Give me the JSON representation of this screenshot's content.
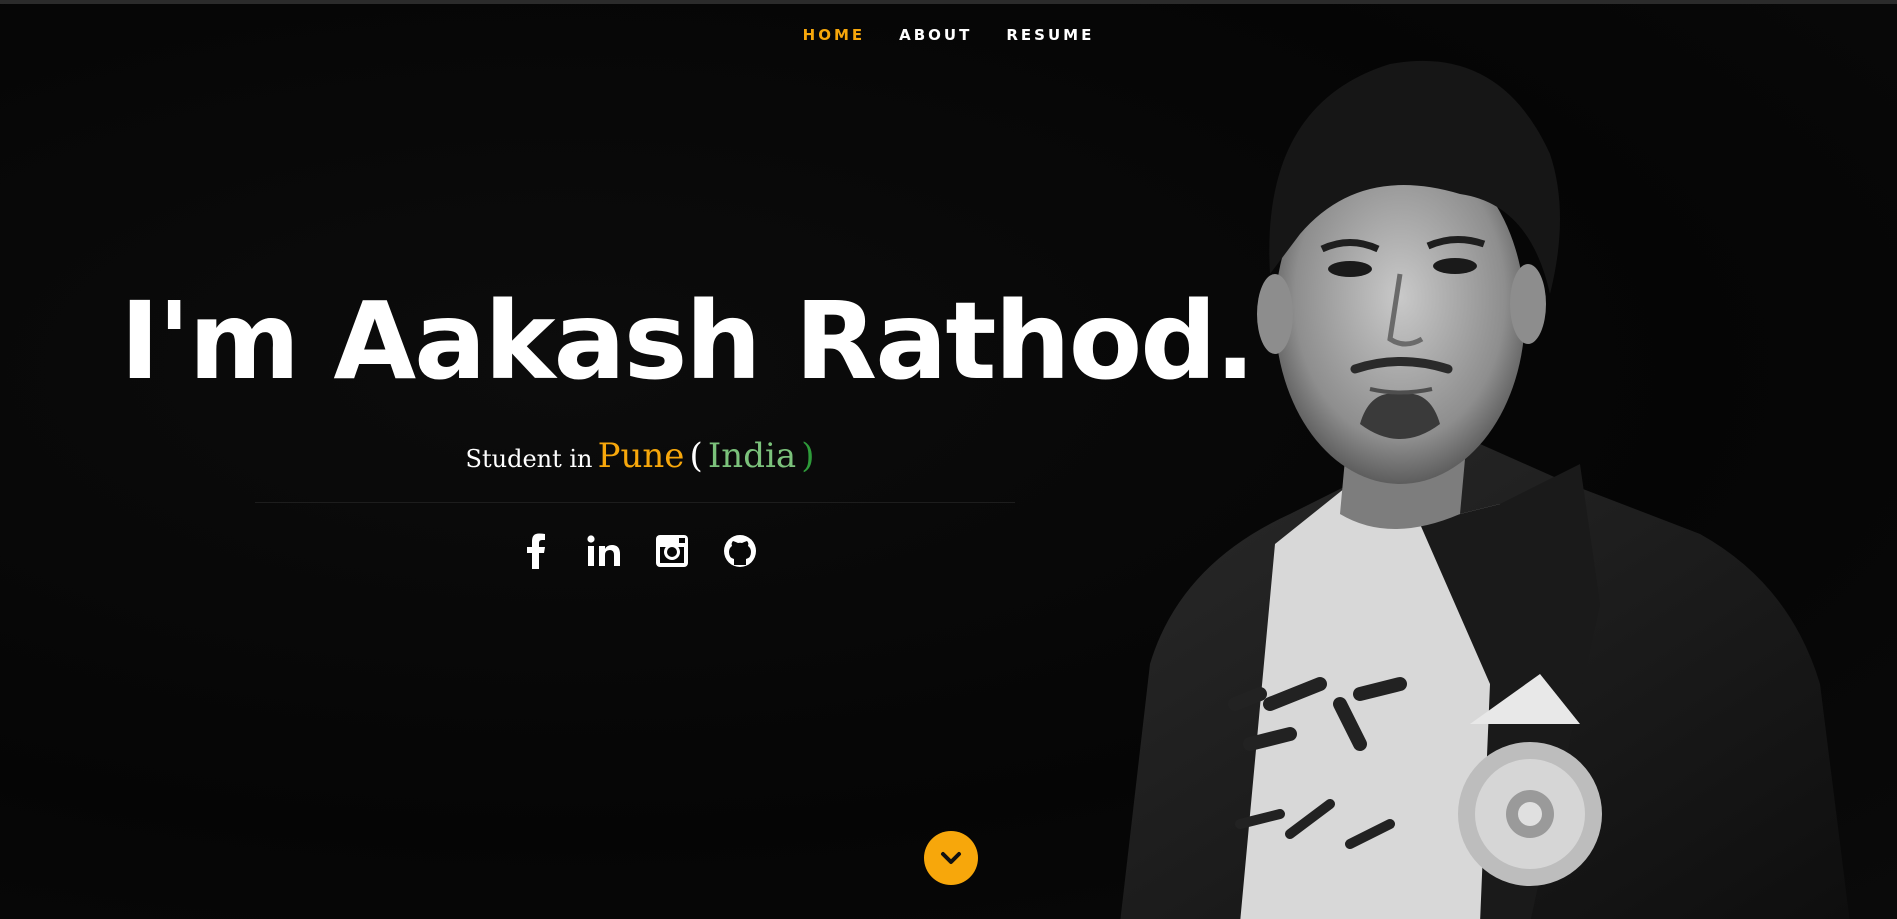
{
  "nav": {
    "items": [
      {
        "label": "HOME",
        "active": true
      },
      {
        "label": "ABOUT",
        "active": false
      },
      {
        "label": "RESUME",
        "active": false
      }
    ]
  },
  "hero": {
    "headline": "I'm Aakash Rathod.",
    "subtitle": {
      "prefix": "Student in",
      "city": "Pune",
      "open": "(",
      "country": "India",
      "close": ")"
    }
  },
  "social": [
    {
      "icon": "facebook-icon"
    },
    {
      "icon": "linkedin-icon"
    },
    {
      "icon": "instagram-icon"
    },
    {
      "icon": "github-icon"
    }
  ],
  "scroll": {
    "icon": "chevron-down-icon"
  },
  "colors": {
    "accent": "#f7a70b",
    "background": "#070707",
    "india_green": "#2e9b3a"
  }
}
